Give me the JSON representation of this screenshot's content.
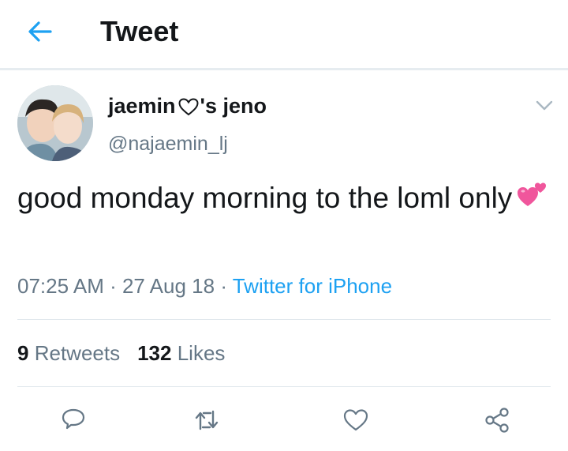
{
  "header": {
    "title": "Tweet",
    "back_icon": "arrow-left-icon"
  },
  "author": {
    "display_name_part1": "jaemin",
    "display_name_part2": "'s jeno",
    "heart_icon": "heart-outline-icon",
    "handle": "@najaemin_lj"
  },
  "tweet": {
    "text": "good monday morning to the loml only",
    "emoji_icon": "two-hearts-emoji"
  },
  "meta": {
    "time": "07:25 AM",
    "sep1": " · ",
    "date": "27 Aug 18",
    "sep2": " · ",
    "source": "Twitter for iPhone"
  },
  "stats": {
    "retweets_count": "9",
    "retweets_label": "Retweets",
    "likes_count": "132",
    "likes_label": "Likes"
  },
  "actions": [
    "reply-icon",
    "retweet-icon",
    "like-icon",
    "share-icon"
  ],
  "colors": {
    "accent": "#1da1f2",
    "secondary_text": "#657786",
    "divider": "#e1e8ed"
  }
}
